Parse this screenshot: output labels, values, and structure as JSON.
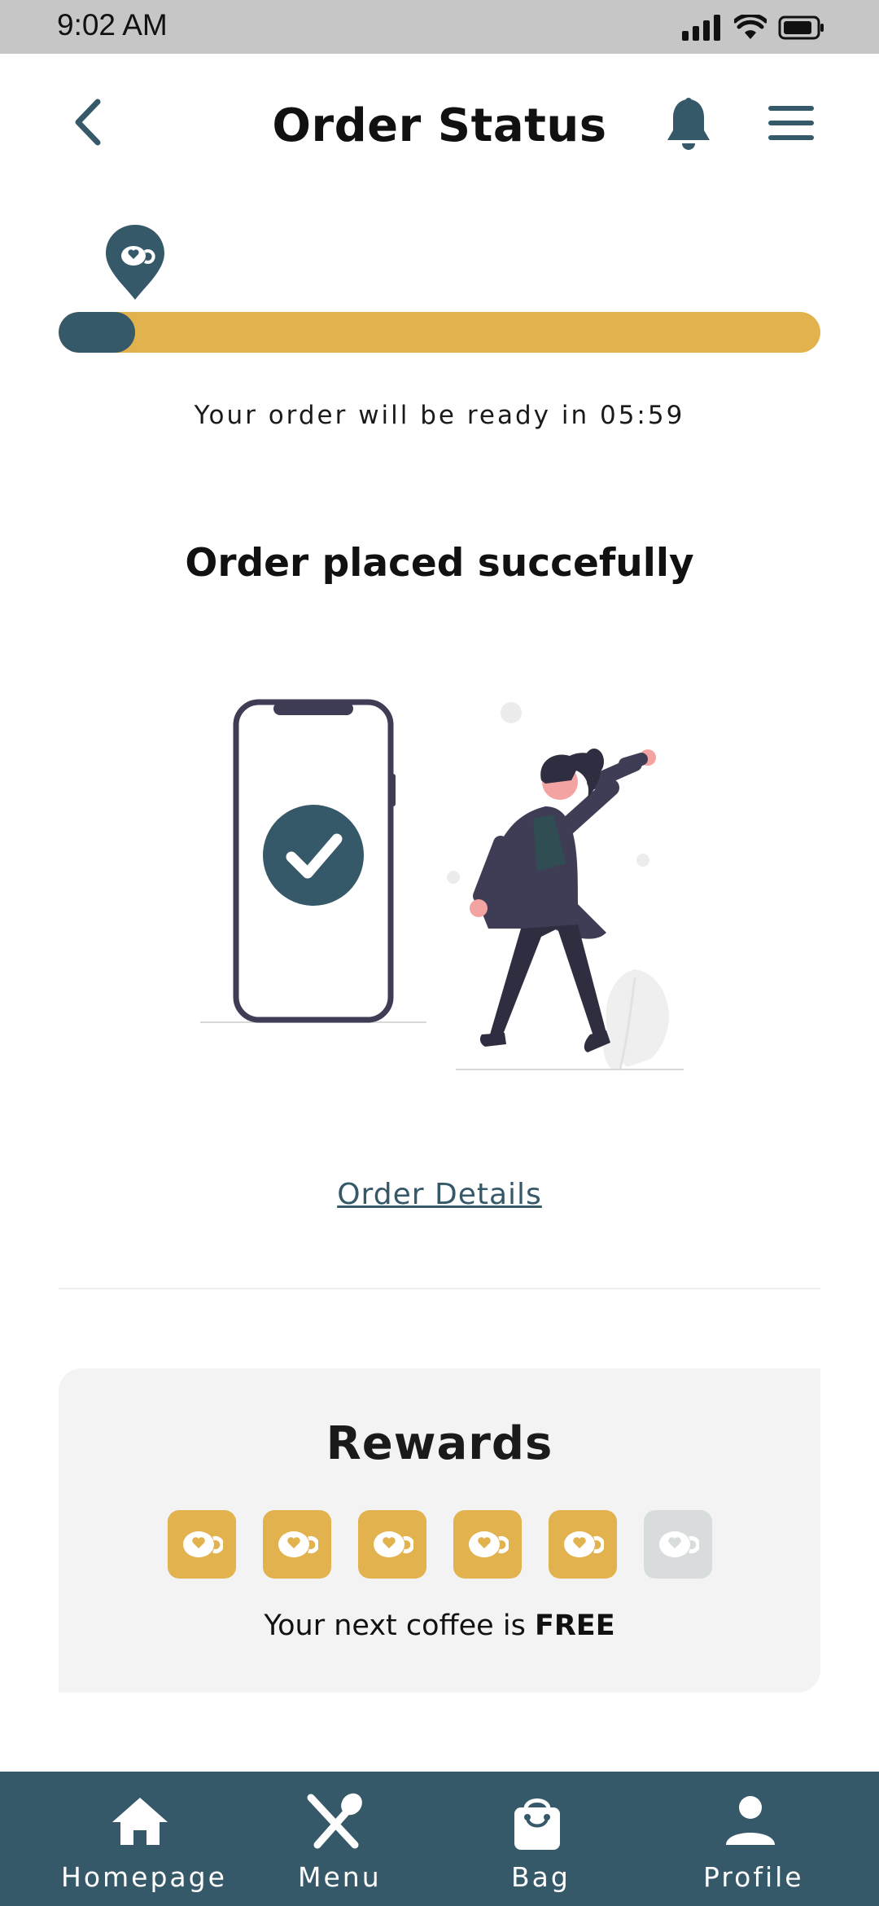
{
  "status_bar": {
    "time": "9:02 AM",
    "icons": [
      "signal-icon",
      "wifi-icon",
      "battery-icon"
    ]
  },
  "header": {
    "title": "Order Status",
    "back_icon": "chevron-left-icon",
    "notification_icon": "bell-icon",
    "menu_icon": "hamburger-menu-icon"
  },
  "progress": {
    "fraction": 0.1,
    "marker_icon": "coffee-location-pin-icon",
    "ready_text": "Your order will be ready in 05:59"
  },
  "confirmation": {
    "title": "Order placed succefully",
    "illustration": "order-confirmed-illustration"
  },
  "order_details_link": "Order Details",
  "rewards": {
    "title": "Rewards",
    "stamps_total": 6,
    "stamps_collected": 5,
    "message_prefix": "Your next coffee is ",
    "message_bold": "FREE"
  },
  "bottom_nav": {
    "items": [
      {
        "label": "Homepage",
        "icon": "home-icon"
      },
      {
        "label": "Menu",
        "icon": "fork-knife-icon"
      },
      {
        "label": "Bag",
        "icon": "shopping-bag-icon"
      },
      {
        "label": "Profile",
        "icon": "user-icon"
      }
    ]
  },
  "colors": {
    "primary": "#36596a",
    "accent": "#e2b24e",
    "card_bg": "#f3f3f3",
    "status_bar_bg": "#c6c6c6"
  }
}
